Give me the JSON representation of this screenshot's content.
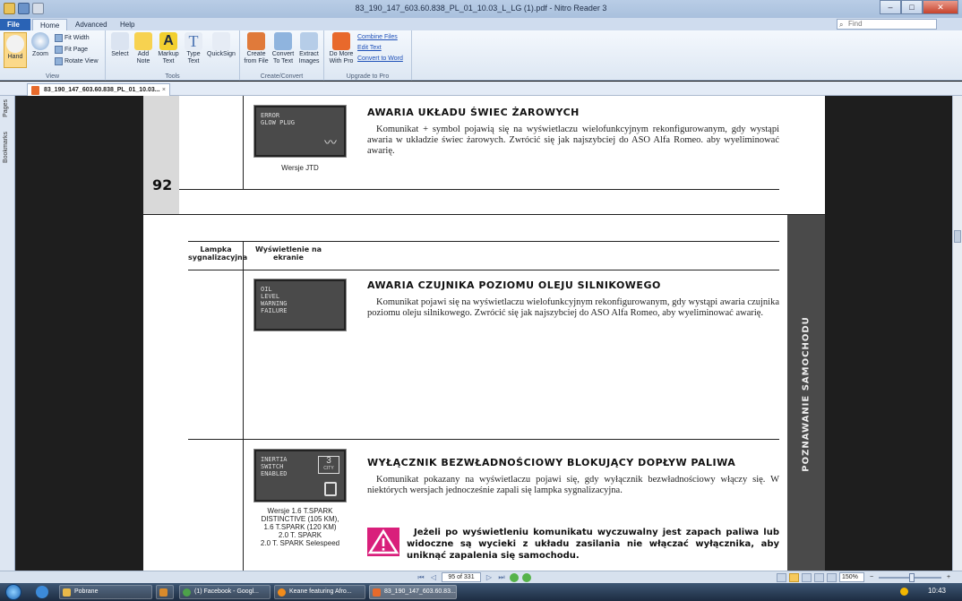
{
  "window": {
    "title": "83_190_147_603.60.838_PL_01_10.03_L_LG (1).pdf - Nitro Reader 3",
    "min": "–",
    "max": "□",
    "close": "✕"
  },
  "menu_tabs": {
    "file": "File",
    "home": "Home",
    "advanced": "Advanced",
    "help": "Help"
  },
  "find": {
    "placeholder": "Find"
  },
  "ribbon": {
    "view": {
      "label": "View",
      "hand": "Hand",
      "zoom": "Zoom",
      "fit_width": "Fit Width",
      "fit_page": "Fit Page",
      "rotate_view": "Rotate View"
    },
    "tools": {
      "label": "Tools",
      "select": "Select",
      "add_note": "Add Note",
      "markup_text": "Markup Text",
      "type_text": "Type Text",
      "quicksign": "QuickSign"
    },
    "create_convert": {
      "label": "Create/Convert",
      "create": "Create from File",
      "convert": "Convert To Text",
      "extract": "Extract Images"
    },
    "upgrade": {
      "label": "Upgrade to Pro",
      "do_more": "Do More With Pro",
      "combine": "Combine Files",
      "edit": "Edit Text",
      "convert_word": "Convert to Word"
    }
  },
  "sidepanel": {
    "pages": "Pages",
    "bookmarks": "Bookmarks"
  },
  "document_tab": {
    "name": "83_190_147_603.60.838_PL_01_10.03...",
    "close": "×"
  },
  "doc": {
    "page1": {
      "page_number": "92",
      "lcd_text": "ERROR\nGLOW PLUG",
      "lcd_symbol": "〰",
      "caption": "Wersje JTD",
      "heading": "AWARIA UKŁADU ŚWIEC ŻAROWYCH",
      "body": "Komunikat + symbol pojawią się na wyświetlaczu wielofunkcyjnym rekonfigurowanym, gdy wystąpi awaria w układzie świec żarowych. Zwrócić się jak najszybciej do ASO Alfa Romeo. aby wyeliminować awarię."
    },
    "page2": {
      "col1_header": "Lampka sygnalizacyjna",
      "col2_header": "Wyświetlenie na ekranie",
      "side_label": "POZNAWANIE SAMOCHODU",
      "s1_lcd": "OIL\nLEVEL\nWARNING\nFAILURE",
      "s1_heading": "AWARIA CZUJNIKA POZIOMU OLEJU SILNIKOWEGO",
      "s1_body": "Komunikat pojawi się na wyświetlaczu wielofunkcyjnym rekonfigurowanym, gdy wystąpi awaria czujnika poziomu oleju silnikowego. Zwrócić się jak najszybciej do ASO Alfa Romeo, aby wyeliminować awarię.",
      "s2_lcd": "INERTIA\nSWITCH\nENABLED",
      "s2_lcd_num": "3",
      "s2_lcd_unit": "CITY",
      "s2_heading": "WYŁĄCZNIK BEZWŁADNOŚCIOWY BLOKUJĄCY DOPŁYW PALIWA",
      "s2_body": "Komunikat pokazany na wyświetlaczu pojawi się, gdy wyłącznik bezwładnościowy włączy się. W niektórych wersjach jednocześnie zapali się lampka sygnalizacyjna.",
      "s2_caption": "Wersje 1.6 T.SPARK\nDISTINCTIVE (105 KM),\n1.6 T.SPARK (120 KM)\n2.0 T. SPARK\n2.0 T. SPARK Selespeed",
      "warning": "Jeżeli po wyświetleniu komunikatu wyczuwalny jest zapach paliwa lub widoczne są wycieki z układu zasilania nie włączać wyłącznika, aby uniknąć zapalenia się samochodu."
    }
  },
  "status": {
    "page_indicator": "95 of 331",
    "zoom": "150%"
  },
  "taskbar": {
    "items": [
      "Pobrane",
      "",
      "(1) Facebook - Googl...",
      "Keane featuring Afro...",
      "83_190_147_603.60.83..."
    ],
    "clock": "10:43"
  }
}
